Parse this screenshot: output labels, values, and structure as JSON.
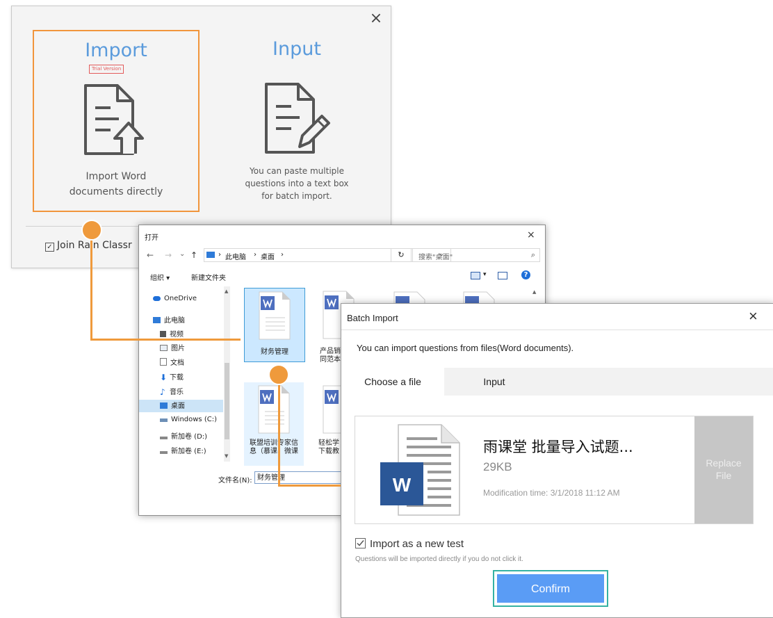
{
  "import_dialog": {
    "import": {
      "title": "Import",
      "badge": "Trial Version",
      "desc_line1": "Import Word",
      "desc_line2": "documents directly"
    },
    "input": {
      "title": "Input",
      "desc_line1": "You can paste multiple",
      "desc_line2": "questions into a text box",
      "desc_line3": "for batch import."
    },
    "join_label": "Join Rain Classr",
    "close_glyph": "×"
  },
  "open_dialog": {
    "title": "打开",
    "close_glyph": "×",
    "nav": {
      "back": "←",
      "forward": "→",
      "recent": "⌄",
      "up": "↑"
    },
    "breadcrumb": [
      "此电脑",
      "桌面"
    ],
    "search_placeholder": "搜索\"桌面\"",
    "toolbar": {
      "organize": "组织 ▾",
      "new_folder": "新建文件夹",
      "help": "?"
    },
    "nav_items": [
      "OneDrive",
      "此电脑",
      "视频",
      "图片",
      "文档",
      "下载",
      "音乐",
      "桌面",
      "Windows (C:)",
      "新加卷 (D:)",
      "新加卷 (E:)"
    ],
    "files": [
      {
        "name_line1": "财务管理",
        "name_line2": ""
      },
      {
        "name_line1": "产品销",
        "name_line2": "同范本"
      },
      {
        "name_line1": "联盟培训专家信",
        "name_line2": "息（慕课、微课"
      },
      {
        "name_line1": "轻松学",
        "name_line2": "下载教"
      }
    ],
    "filename_label": "文件名(N):",
    "filename_value": "财务管理"
  },
  "batch_dialog": {
    "title": "Batch Import",
    "close_glyph": "×",
    "hint": "You can import questions from files(Word documents).",
    "tabs": [
      "Choose a file",
      "Input"
    ],
    "file": {
      "name": "雨课堂 批量导入试题...",
      "size": "29KB",
      "modified": "Modification time: 3/1/2018 11:12 AM",
      "icon_letter": "W"
    },
    "replace_line1": "Replace",
    "replace_line2": "File",
    "new_test_label": "Import as a new test",
    "new_test_checked": true,
    "new_test_hint": "Questions will be imported directly if you do not click it.",
    "confirm": "Confirm"
  },
  "colors": {
    "accent_orange": "#ef9a3c",
    "link_blue": "#5b9bdc",
    "confirm_blue": "#5a9cf5",
    "teal_focus": "#35b2a3",
    "word_blue": "#2b5797"
  }
}
